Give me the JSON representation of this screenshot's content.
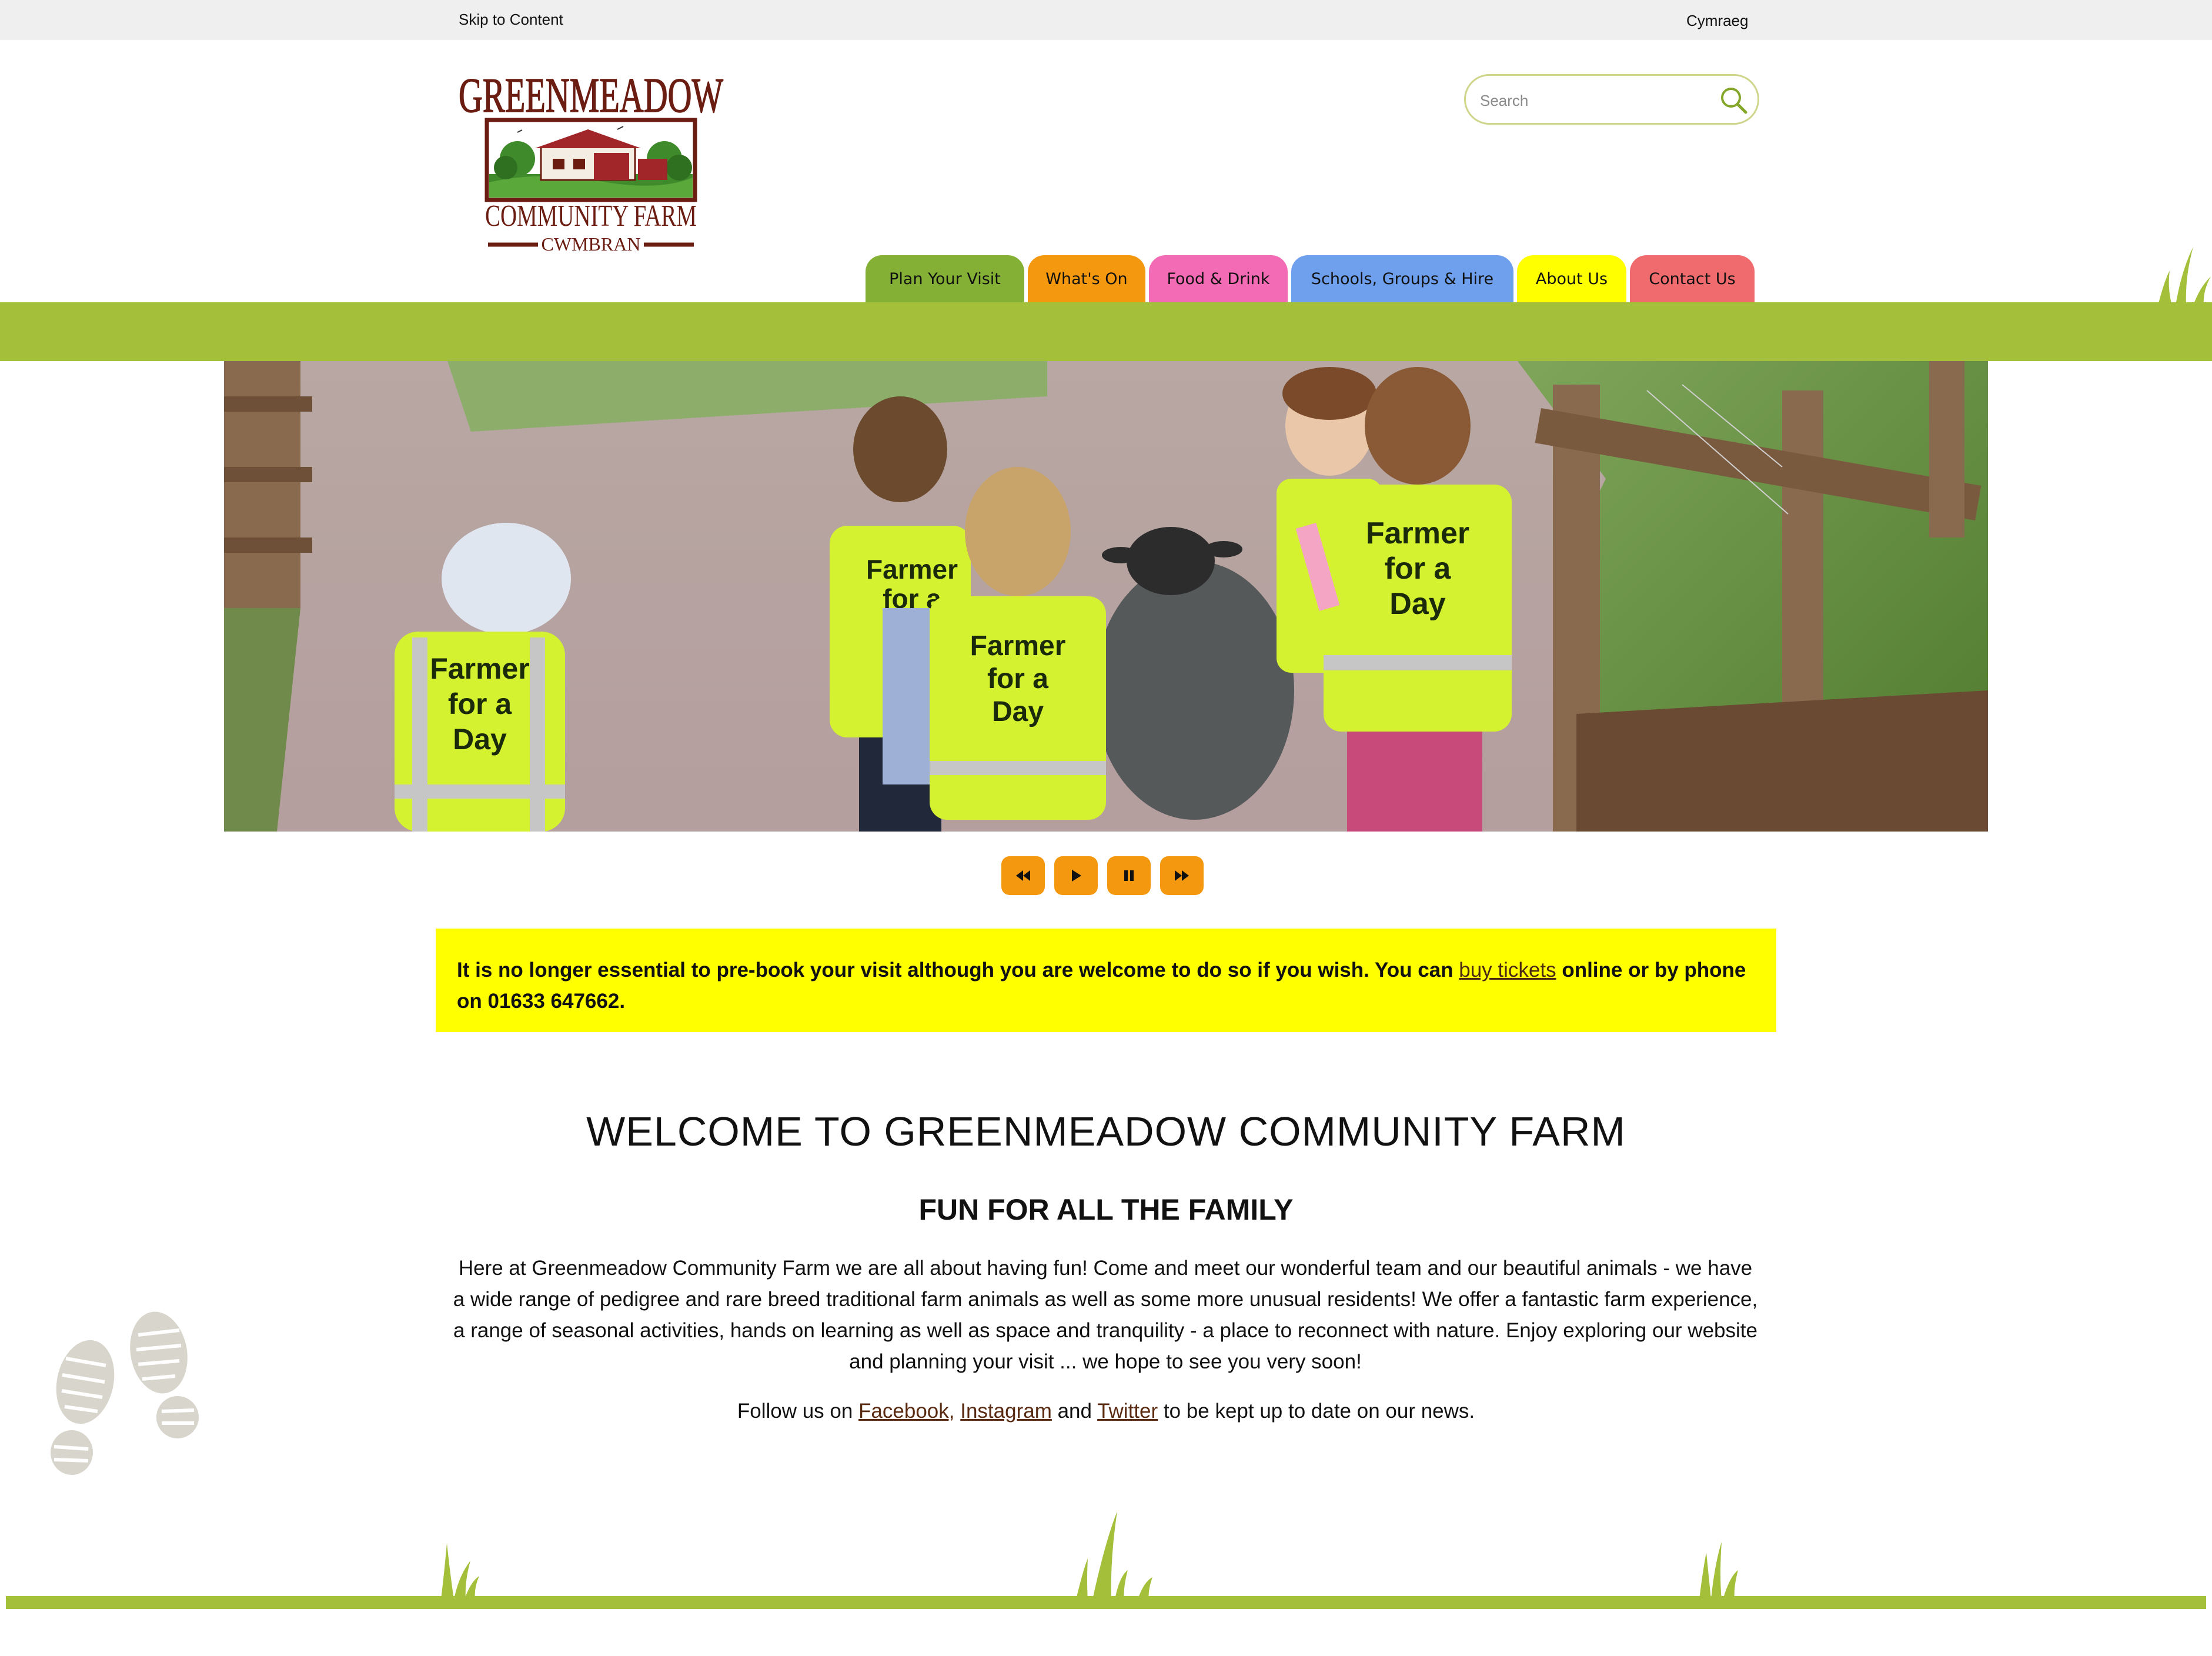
{
  "topbar": {
    "skip_link": "Skip to Content",
    "language_link": "Cymraeg"
  },
  "logo": {
    "line1": "GREENMEADOW",
    "line2": "COMMUNITY FARM",
    "line3": "CWMBRAN"
  },
  "search": {
    "placeholder": "Search",
    "icon": "search-icon"
  },
  "nav": {
    "tabs": [
      {
        "label": "Plan Your Visit",
        "color": "#84b035"
      },
      {
        "label": "What's On",
        "color": "#f4980f"
      },
      {
        "label": "Food & Drink",
        "color": "#f26bb4"
      },
      {
        "label": "Schools, Groups & Hire",
        "color": "#6fa0ee"
      },
      {
        "label": "About Us",
        "color": "#ffff00"
      },
      {
        "label": "Contact Us",
        "color": "#ef6b6e"
      }
    ]
  },
  "hero": {
    "vest_text": [
      "Farmer",
      "for a",
      "Day"
    ]
  },
  "slider_controls": [
    "rewind-icon",
    "play-icon",
    "pause-icon",
    "fast-forward-icon"
  ],
  "notice": {
    "text_before": "It is no longer essential to pre-book your visit although you are welcome to do so if you wish. You can ",
    "link": "buy tickets",
    "text_after": " online or by phone on 01633 647662."
  },
  "welcome": {
    "title": "WELCOME TO GREENMEADOW COMMUNITY FARM",
    "subtitle": "FUN FOR ALL THE FAMILY",
    "body": "Here at Greenmeadow Community Farm we are all about having fun! Come and meet our wonderful team and our beautiful animals - we have a wide range of pedigree and rare breed traditional farm animals as well as some more unusual residents! We offer a fantastic farm experience, a range of seasonal activities, hands on learning as well as space and tranquility - a place to reconnect with nature. Enjoy exploring our website and planning your visit ... we hope to see you very soon!",
    "follow_prefix": "Follow us on ",
    "facebook": "Facebook,",
    "instagram": "Instagram",
    "and": " and ",
    "twitter": "Twitter",
    "follow_suffix": " to be kept up to date on our news."
  },
  "colors": {
    "brand_green": "#a4bf3a",
    "accent_orange": "#f4980f",
    "notice_yellow": "#ffff00",
    "logo_brown": "#6b1d12"
  }
}
